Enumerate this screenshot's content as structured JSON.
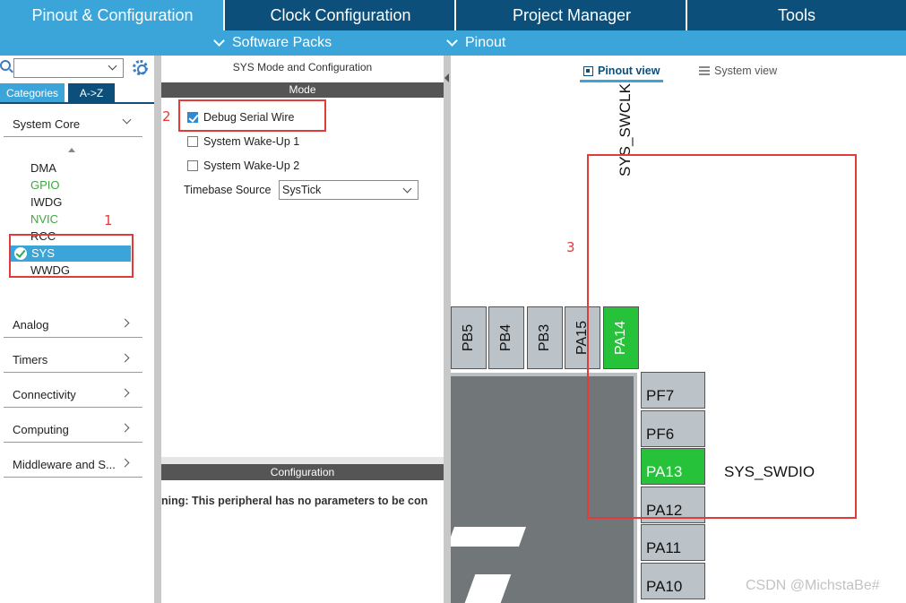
{
  "top_tabs": [
    {
      "label": "Pinout & Configuration",
      "active": true
    },
    {
      "label": "Clock Configuration",
      "active": false
    },
    {
      "label": "Project Manager",
      "active": false
    },
    {
      "label": "Tools",
      "active": false
    }
  ],
  "sub_bar": {
    "software_packs": "Software Packs",
    "pinout": "Pinout"
  },
  "left": {
    "search_value": "",
    "tabs": {
      "categories": "Categories",
      "az": "A->Z"
    },
    "groups": {
      "system_core": "System Core",
      "analog": "Analog",
      "timers": "Timers",
      "connectivity": "Connectivity",
      "computing": "Computing",
      "middleware": "Middleware and S..."
    },
    "peripherals": [
      "DMA",
      "GPIO",
      "IWDG",
      "NVIC",
      "RCC",
      "SYS",
      "WWDG"
    ]
  },
  "middle": {
    "title": "SYS Mode and Configuration",
    "mode_header": "Mode",
    "debug_serial_wire": "Debug Serial Wire",
    "wakeup1": "System Wake-Up 1",
    "wakeup2": "System Wake-Up 2",
    "timebase_label": "Timebase Source",
    "timebase_value": "SysTick",
    "config_header": "Configuration",
    "config_message": "ning: This peripheral has no parameters to be con"
  },
  "right": {
    "pinout_view": "Pinout view",
    "system_view": "System view",
    "top_pins": [
      "PB5",
      "PB4",
      "PB3",
      "PA15",
      "PA14"
    ],
    "side_pins": [
      "PF7",
      "PF6",
      "PA13",
      "PA12",
      "PA11",
      "PA10"
    ],
    "signal_swclk": "SYS_SWCLK",
    "signal_swdio": "SYS_SWDIO",
    "watermark": "CSDN @MichstaBe#"
  },
  "annotations": [
    "1",
    "2",
    "3"
  ],
  "colors": {
    "accent": "#3ba4d8",
    "dark": "#0c4f7a",
    "pin_active": "#26c23a",
    "annotation": "#e23b3b"
  }
}
